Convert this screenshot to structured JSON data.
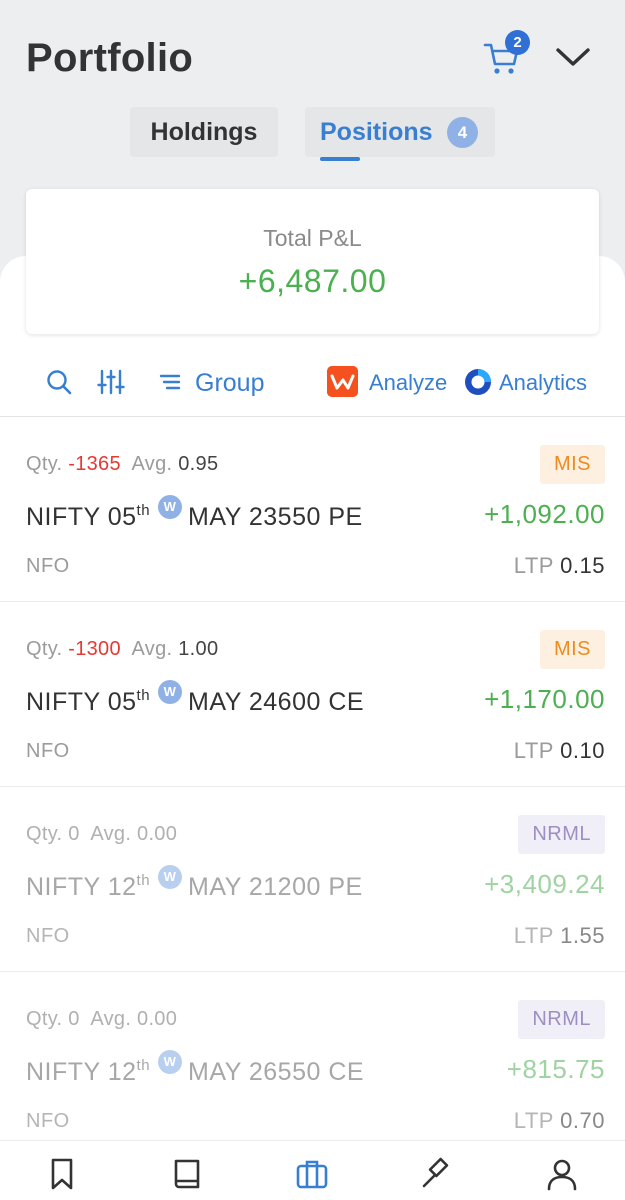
{
  "header": {
    "title": "Portfolio",
    "cart_count": "2"
  },
  "tabs": {
    "holdings": "Holdings",
    "positions": "Positions",
    "positions_count": "4"
  },
  "summary": {
    "label": "Total P&L",
    "value": "+6,487.00"
  },
  "toolbar": {
    "group_label": "Group",
    "analyze_label": "Analyze",
    "analytics_label": "Analytics"
  },
  "positions": [
    {
      "qty_label": "Qty.",
      "qty": "-1365",
      "avg_label": "Avg.",
      "avg": "0.95",
      "product": "MIS",
      "symbol": "NIFTY 05",
      "suffix": "th",
      "weekly": "W",
      "contract": "MAY 23550 PE",
      "pnl": "+1,092.00",
      "exchange": "NFO",
      "ltp_label": "LTP",
      "ltp": "0.15"
    },
    {
      "qty_label": "Qty.",
      "qty": "-1300",
      "avg_label": "Avg.",
      "avg": "1.00",
      "product": "MIS",
      "symbol": "NIFTY 05",
      "suffix": "th",
      "weekly": "W",
      "contract": "MAY 24600 CE",
      "pnl": "+1,170.00",
      "exchange": "NFO",
      "ltp_label": "LTP",
      "ltp": "0.10"
    },
    {
      "qty_label": "Qty.",
      "qty": "0",
      "avg_label": "Avg.",
      "avg": "0.00",
      "product": "NRML",
      "symbol": "NIFTY 12",
      "suffix": "th",
      "weekly": "W",
      "contract": "MAY 21200 PE",
      "pnl": "+3,409.24",
      "exchange": "NFO",
      "ltp_label": "LTP",
      "ltp": "1.55"
    },
    {
      "qty_label": "Qty.",
      "qty": "0",
      "avg_label": "Avg.",
      "avg": "0.00",
      "product": "NRML",
      "symbol": "NIFTY 12",
      "suffix": "th",
      "weekly": "W",
      "contract": "MAY 26550 CE",
      "pnl": "+815.75",
      "exchange": "NFO",
      "ltp_label": "LTP",
      "ltp": "0.70"
    }
  ],
  "colors": {
    "accent": "#387ed1",
    "profit": "#4caf50",
    "loss": "#e53935",
    "mis": "#ef8b1e",
    "nrml": "#9e8fc2"
  }
}
